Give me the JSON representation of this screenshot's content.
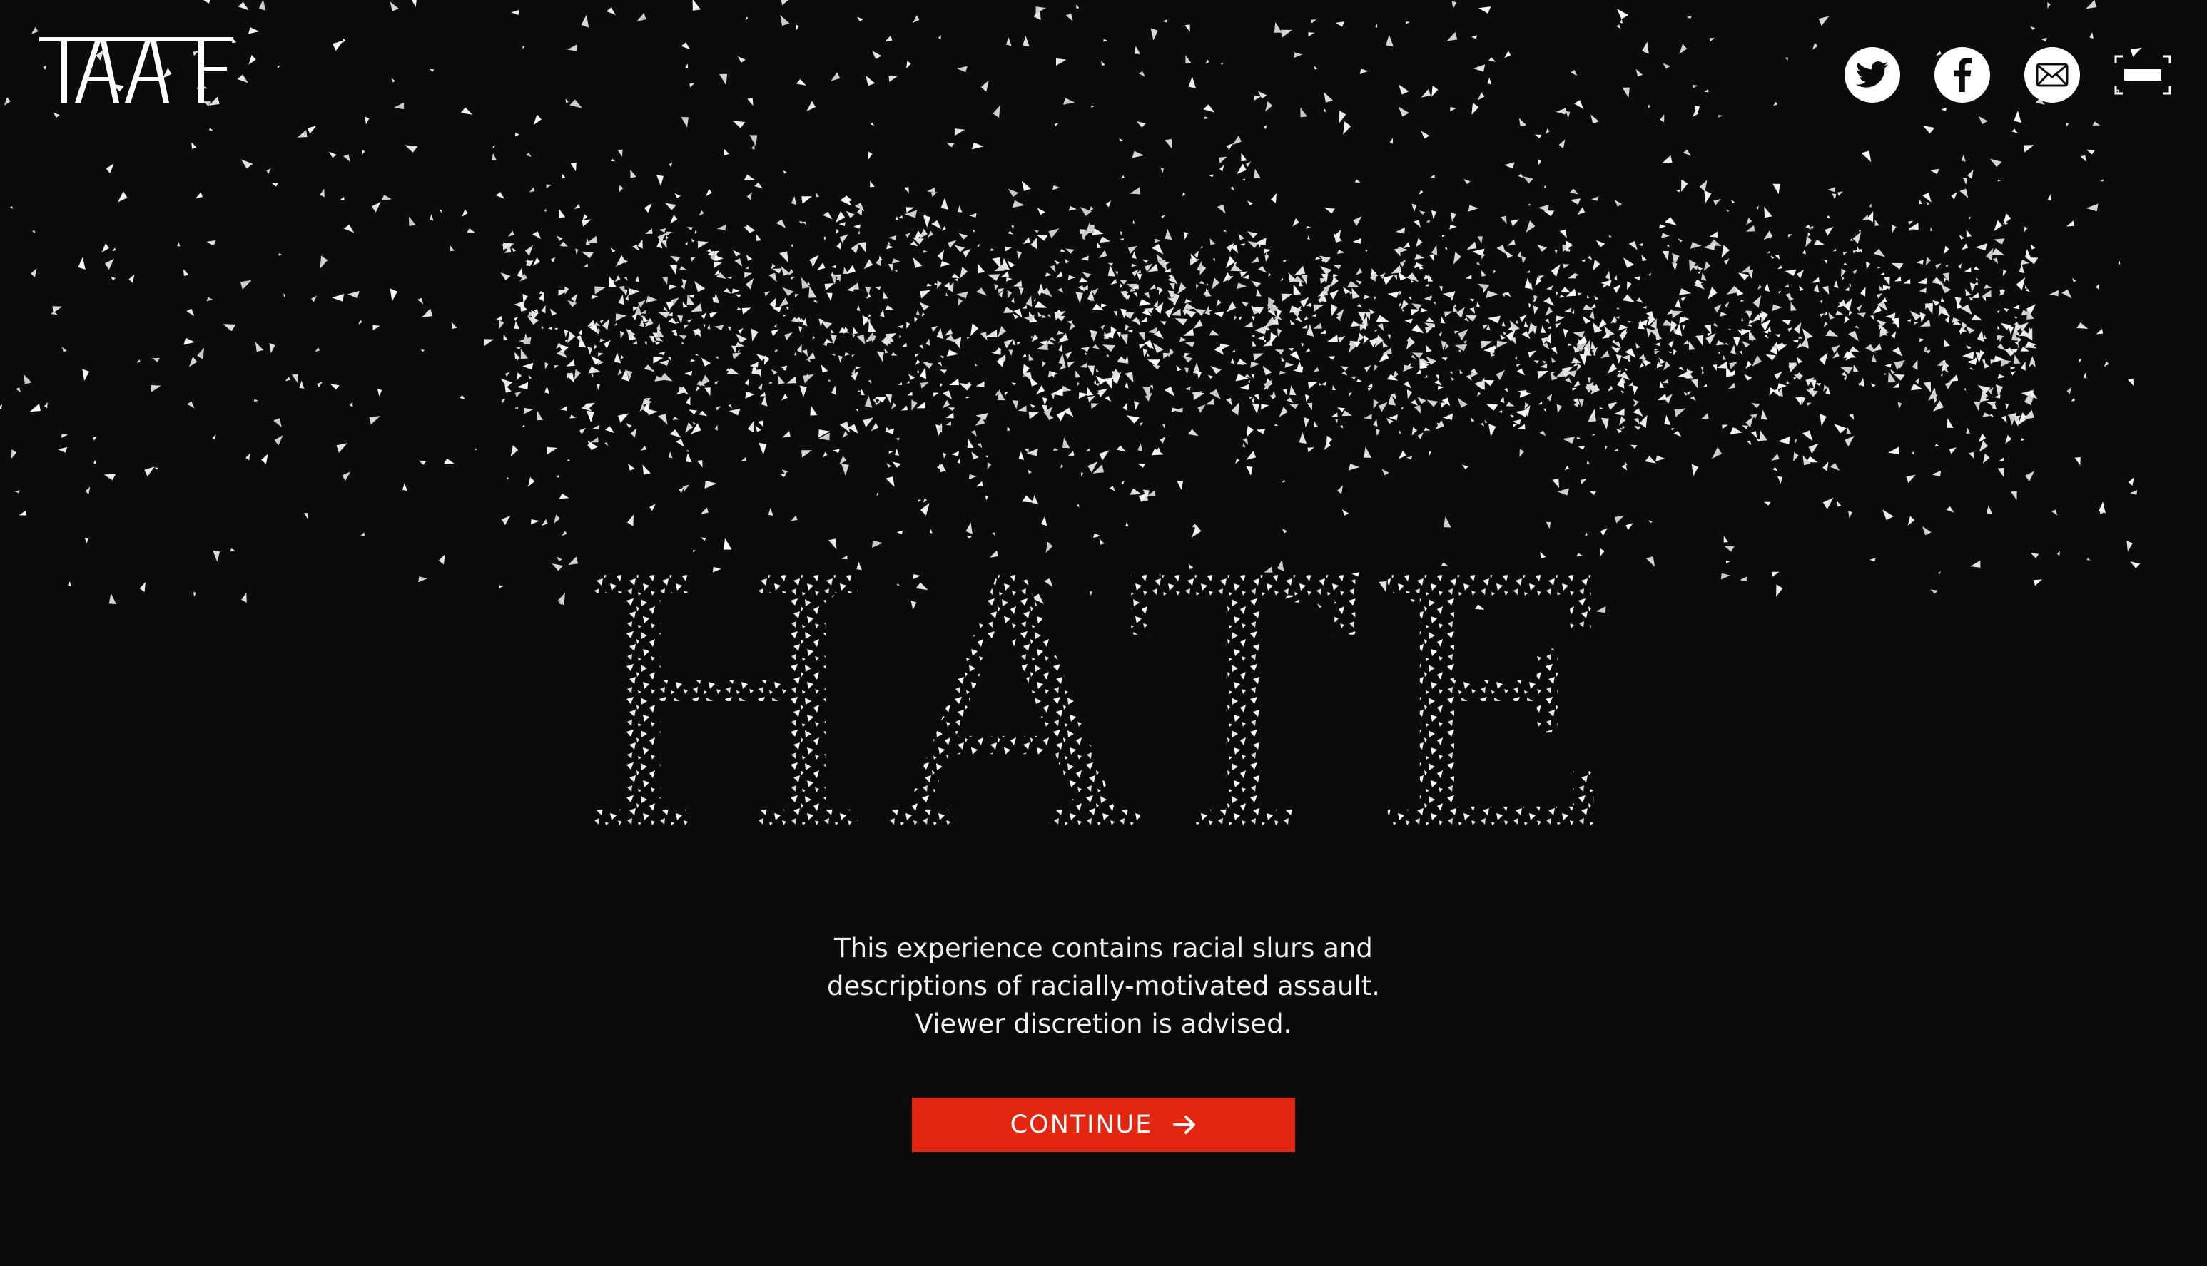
{
  "brand": {
    "logo_name": "taaf-logo"
  },
  "header": {
    "icons": [
      "twitter-icon",
      "facebook-icon",
      "email-icon",
      "fullscreen-icon"
    ]
  },
  "hero": {
    "title": "HATE"
  },
  "warning": {
    "lines": [
      "This experience contains racial slurs and",
      "descriptions of racially-motivated assault.",
      "Viewer discretion is advised."
    ]
  },
  "cta": {
    "label": "CONTINUE",
    "icon": "arrow-right-icon"
  },
  "colors": {
    "background": "#0b0b0b",
    "accent": "#e3260f",
    "foreground": "#ffffff"
  }
}
